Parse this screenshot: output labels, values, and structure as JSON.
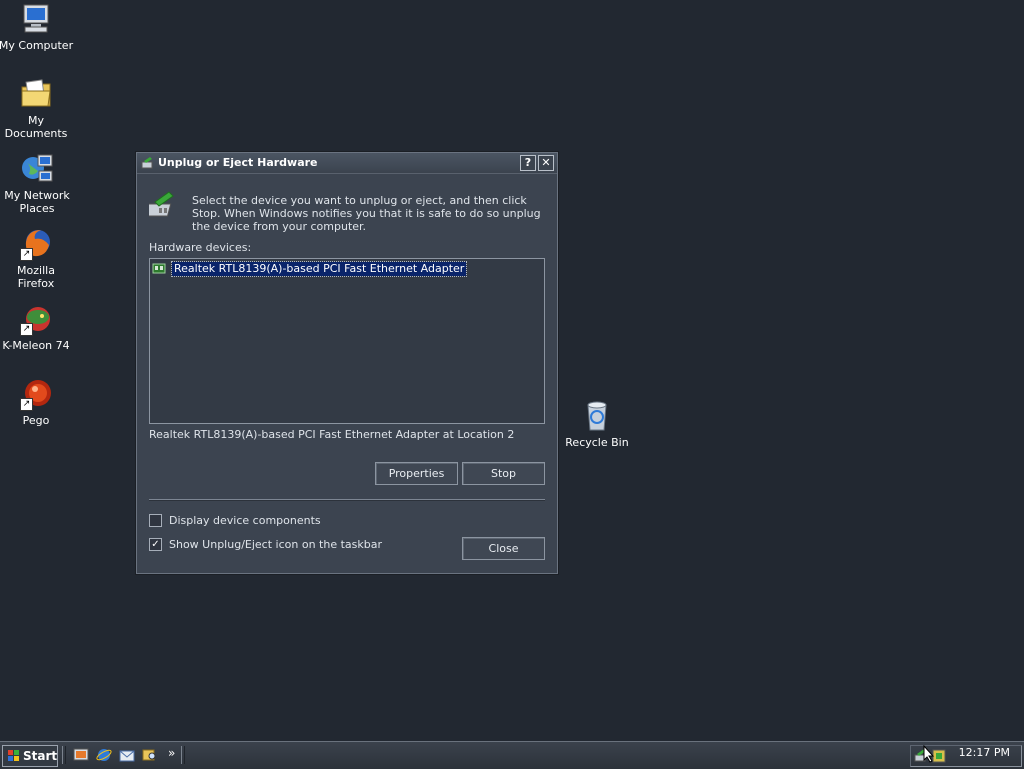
{
  "desktop": {
    "icons": [
      {
        "label": "My Computer",
        "icon": "computer-icon"
      },
      {
        "label": "My Documents",
        "icon": "folder-documents-icon"
      },
      {
        "label": "My Network Places",
        "icon": "network-places-icon"
      },
      {
        "label": "Mozilla Firefox",
        "icon": "firefox-icon"
      },
      {
        "label": "K-Meleon 74",
        "icon": "kmeleon-icon"
      },
      {
        "label": "Pego",
        "icon": "pego-icon"
      },
      {
        "label": "Recycle Bin",
        "icon": "recycle-bin-icon"
      }
    ],
    "background_color": "#222831"
  },
  "dialog": {
    "title": "Unplug or Eject Hardware",
    "help_button": "?",
    "close_button": "✕",
    "intro": "Select the device you want to unplug or eject, and then click Stop. When Windows notifies you that it is safe to do so unplug the device from your computer.",
    "hardware_label": "Hardware devices:",
    "devices": [
      {
        "name": "Realtek RTL8139(A)-based PCI Fast Ethernet Adapter",
        "selected": true
      }
    ],
    "location_text": "Realtek RTL8139(A)-based PCI Fast Ethernet Adapter at Location 2",
    "properties_label": "Properties",
    "stop_label": "Stop",
    "display_components_label": "Display device components",
    "display_components_checked": false,
    "show_icon_label": "Show Unplug/Eject icon on the taskbar",
    "show_icon_checked": true,
    "close_label": "Close"
  },
  "taskbar": {
    "start_label": "Start",
    "chevron": "»",
    "clock": "12:17 PM"
  },
  "colors": {
    "selection": "#0a246a",
    "dialog_bg": "#3c4450"
  }
}
